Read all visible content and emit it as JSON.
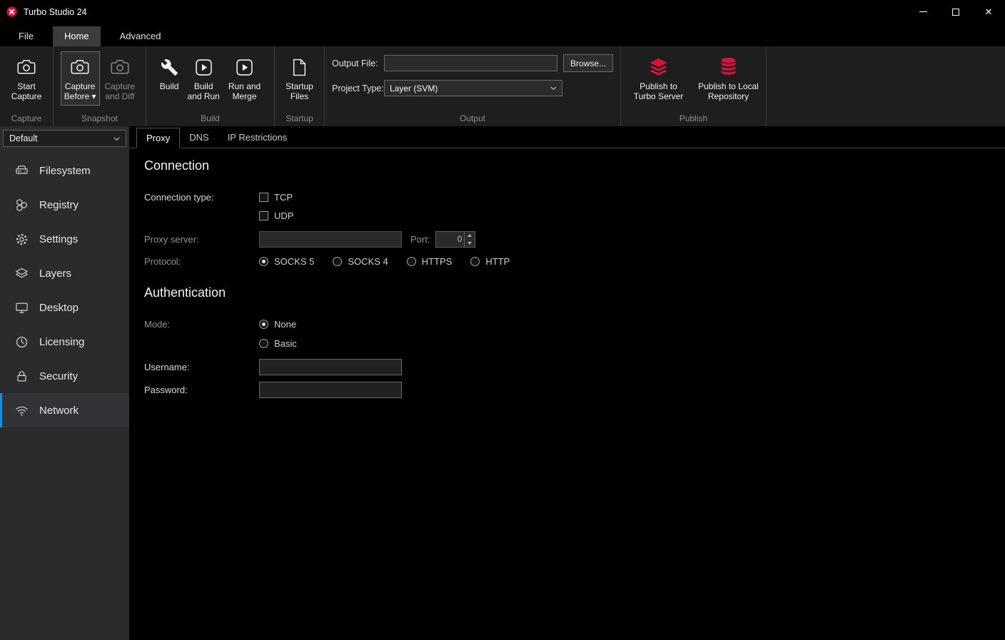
{
  "colors": {
    "accent_red": "#d8133b",
    "accent_blue": "#1a8cd8",
    "titlebar_bg": "#000000",
    "ribbon_bg": "#1e1e1e",
    "sidebar_bg": "#2b2b2d",
    "content_bg": "#000000"
  },
  "window": {
    "title": "Turbo Studio 24"
  },
  "menu": {
    "tabs": [
      {
        "label": "File",
        "active": false
      },
      {
        "label": "Home",
        "active": true
      },
      {
        "label": "Advanced",
        "active": false
      }
    ]
  },
  "ribbon": {
    "capture": {
      "group_label": "Capture",
      "start_capture_label": "Start\nCapture"
    },
    "snapshot": {
      "group_label": "Snapshot",
      "capture_before_label": "Capture\nBefore ▾",
      "capture_and_diff_label": "Capture\nand Diff"
    },
    "build": {
      "group_label": "Build",
      "build_label": "Build",
      "build_and_run_label": "Build\nand Run",
      "run_and_merge_label": "Run and\nMerge"
    },
    "startup": {
      "group_label": "Startup",
      "startup_files_label": "Startup\nFiles"
    },
    "output": {
      "group_label": "Output",
      "output_file_label": "Output File:",
      "output_file_value": "",
      "browse_label": "Browse...",
      "project_type_label": "Project Type:",
      "project_type_value": "Layer (SVM)"
    },
    "publish": {
      "group_label": "Publish",
      "turbo_server_label": "Publish to\nTurbo Server",
      "local_repository_label": "Publish to Local\nRepository"
    }
  },
  "sidebar": {
    "profile_selector_value": "Default",
    "items": [
      {
        "label": "Filesystem",
        "active": false
      },
      {
        "label": "Registry",
        "active": false
      },
      {
        "label": "Settings",
        "active": false
      },
      {
        "label": "Layers",
        "active": false
      },
      {
        "label": "Desktop",
        "active": false
      },
      {
        "label": "Licensing",
        "active": false
      },
      {
        "label": "Security",
        "active": false
      },
      {
        "label": "Network",
        "active": true
      }
    ]
  },
  "content": {
    "tabs": [
      {
        "label": "Proxy",
        "active": true
      },
      {
        "label": "DNS",
        "active": false
      },
      {
        "label": "IP Restrictions",
        "active": false
      }
    ],
    "connection": {
      "heading": "Connection",
      "connection_type_label": "Connection type:",
      "tcp": {
        "label": "TCP",
        "checked": false
      },
      "udp": {
        "label": "UDP",
        "checked": false
      },
      "proxy_server_label": "Proxy server:",
      "proxy_server_value": "",
      "port_label": "Port:",
      "port_value": "0",
      "protocol_label": "Protocol:",
      "protocols": [
        {
          "label": "SOCKS 5",
          "selected": true
        },
        {
          "label": "SOCKS 4",
          "selected": false
        },
        {
          "label": "HTTPS",
          "selected": false
        },
        {
          "label": "HTTP",
          "selected": false
        }
      ]
    },
    "authentication": {
      "heading": "Authentication",
      "mode_label": "Mode:",
      "modes": [
        {
          "label": "None",
          "selected": true
        },
        {
          "label": "Basic",
          "selected": false
        }
      ],
      "username_label": "Username:",
      "username_value": "",
      "password_label": "Password:",
      "password_value": ""
    }
  }
}
